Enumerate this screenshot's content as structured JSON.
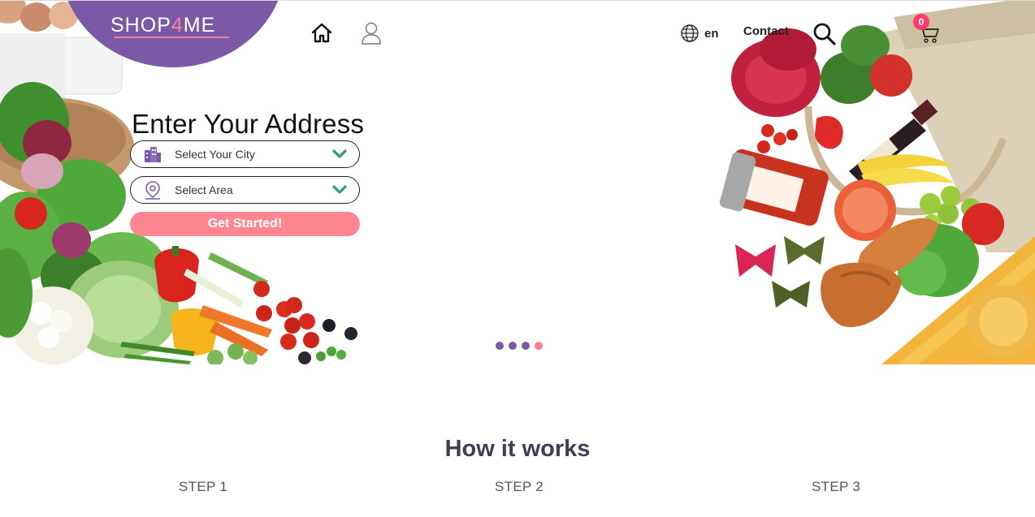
{
  "header": {
    "logo": {
      "text_before": "SH",
      "pin": "O",
      "text_mid": "P",
      "four": "4",
      "text_after": "ME",
      "blob_color": "#7a5aa6",
      "accent_color": "#ff7f9a"
    },
    "nav": {
      "home_icon": "home-icon",
      "user_icon": "user-icon",
      "language": "en",
      "language_icon": "globe-icon",
      "contact": "Contact",
      "search_icon": "search-icon",
      "cart_icon": "cart-icon",
      "cart_count": "0"
    }
  },
  "hero": {
    "title": "Enter Your Address",
    "city_select": {
      "label": "Select Your City",
      "icon": "city-buildings-icon"
    },
    "area_select": {
      "label": "Select Area",
      "icon": "location-pin-icon"
    },
    "cta_label": "Get Started!",
    "cta_color": "#ff8591",
    "carousel": {
      "slide_count": 4,
      "active_index": 3
    }
  },
  "how_it_works": {
    "title": "How it works",
    "steps": [
      {
        "label": "STEP 1"
      },
      {
        "label": "STEP 2"
      },
      {
        "label": "STEP 3"
      }
    ]
  }
}
